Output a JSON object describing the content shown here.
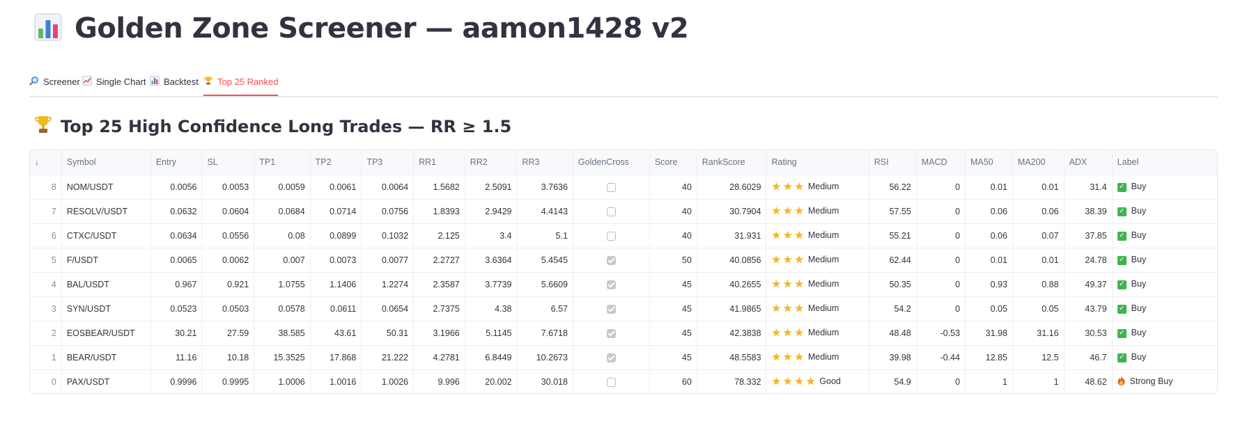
{
  "page": {
    "title_icon": "bar-chart-icon",
    "title": "Golden Zone Screener — aamon1428 v2"
  },
  "tabs": [
    {
      "label": "Screener",
      "icon": "magnifier-icon",
      "active": false
    },
    {
      "label": "Single Chart",
      "icon": "line-chart-icon",
      "active": false
    },
    {
      "label": "Backtest",
      "icon": "bar-chart-icon",
      "active": false
    },
    {
      "label": "Top 25 Ranked",
      "icon": "trophy-icon",
      "active": true
    }
  ],
  "section": {
    "icon": "trophy-icon",
    "title": "Top 25 High Confidence Long Trades — RR ≥ 1.5"
  },
  "table": {
    "sort_indicator": "↓",
    "columns": [
      "Symbol",
      "Entry",
      "SL",
      "TP1",
      "TP2",
      "TP3",
      "RR1",
      "RR2",
      "RR3",
      "GoldenCross",
      "Score",
      "RankScore",
      "Rating",
      "RSI",
      "MACD",
      "MA50",
      "MA200",
      "ADX",
      "Label"
    ],
    "rows": [
      {
        "idx": "8",
        "symbol": "NOM/USDT",
        "entry": "0.0056",
        "sl": "0.0053",
        "tp1": "0.0059",
        "tp2": "0.0061",
        "tp3": "0.0064",
        "rr1": "1.5682",
        "rr2": "2.5091",
        "rr3": "3.7636",
        "golden_cross": false,
        "score": "40",
        "rank_score": "28.6029",
        "stars": 3,
        "rating": "Medium",
        "rsi": "56.22",
        "macd": "0",
        "ma50": "0.01",
        "ma200": "0.01",
        "adx": "31.4",
        "label": "Buy",
        "label_icon": "check-icon"
      },
      {
        "idx": "7",
        "symbol": "RESOLV/USDT",
        "entry": "0.0632",
        "sl": "0.0604",
        "tp1": "0.0684",
        "tp2": "0.0714",
        "tp3": "0.0756",
        "rr1": "1.8393",
        "rr2": "2.9429",
        "rr3": "4.4143",
        "golden_cross": false,
        "score": "40",
        "rank_score": "30.7904",
        "stars": 3,
        "rating": "Medium",
        "rsi": "57.55",
        "macd": "0",
        "ma50": "0.06",
        "ma200": "0.06",
        "adx": "38.39",
        "label": "Buy",
        "label_icon": "check-icon"
      },
      {
        "idx": "6",
        "symbol": "CTXC/USDT",
        "entry": "0.0634",
        "sl": "0.0556",
        "tp1": "0.08",
        "tp2": "0.0899",
        "tp3": "0.1032",
        "rr1": "2.125",
        "rr2": "3.4",
        "rr3": "5.1",
        "golden_cross": false,
        "score": "40",
        "rank_score": "31.931",
        "stars": 3,
        "rating": "Medium",
        "rsi": "55.21",
        "macd": "0",
        "ma50": "0.06",
        "ma200": "0.07",
        "adx": "37.85",
        "label": "Buy",
        "label_icon": "check-icon"
      },
      {
        "idx": "5",
        "symbol": "F/USDT",
        "entry": "0.0065",
        "sl": "0.0062",
        "tp1": "0.007",
        "tp2": "0.0073",
        "tp3": "0.0077",
        "rr1": "2.2727",
        "rr2": "3.6364",
        "rr3": "5.4545",
        "golden_cross": true,
        "score": "50",
        "rank_score": "40.0856",
        "stars": 3,
        "rating": "Medium",
        "rsi": "62.44",
        "macd": "0",
        "ma50": "0.01",
        "ma200": "0.01",
        "adx": "24.78",
        "label": "Buy",
        "label_icon": "check-icon"
      },
      {
        "idx": "4",
        "symbol": "BAL/USDT",
        "entry": "0.967",
        "sl": "0.921",
        "tp1": "1.0755",
        "tp2": "1.1406",
        "tp3": "1.2274",
        "rr1": "2.3587",
        "rr2": "3.7739",
        "rr3": "5.6609",
        "golden_cross": true,
        "score": "45",
        "rank_score": "40.2655",
        "stars": 3,
        "rating": "Medium",
        "rsi": "50.35",
        "macd": "0",
        "ma50": "0.93",
        "ma200": "0.88",
        "adx": "49.37",
        "label": "Buy",
        "label_icon": "check-icon"
      },
      {
        "idx": "3",
        "symbol": "SYN/USDT",
        "entry": "0.0523",
        "sl": "0.0503",
        "tp1": "0.0578",
        "tp2": "0.0611",
        "tp3": "0.0654",
        "rr1": "2.7375",
        "rr2": "4.38",
        "rr3": "6.57",
        "golden_cross": true,
        "score": "45",
        "rank_score": "41.9865",
        "stars": 3,
        "rating": "Medium",
        "rsi": "54.2",
        "macd": "0",
        "ma50": "0.05",
        "ma200": "0.05",
        "adx": "43.79",
        "label": "Buy",
        "label_icon": "check-icon"
      },
      {
        "idx": "2",
        "symbol": "EOSBEAR/USDT",
        "entry": "30.21",
        "sl": "27.59",
        "tp1": "38.585",
        "tp2": "43.61",
        "tp3": "50.31",
        "rr1": "3.1966",
        "rr2": "5.1145",
        "rr3": "7.6718",
        "golden_cross": true,
        "score": "45",
        "rank_score": "42.3838",
        "stars": 3,
        "rating": "Medium",
        "rsi": "48.48",
        "macd": "-0.53",
        "ma50": "31.98",
        "ma200": "31.16",
        "adx": "30.53",
        "label": "Buy",
        "label_icon": "check-icon"
      },
      {
        "idx": "1",
        "symbol": "BEAR/USDT",
        "entry": "11.16",
        "sl": "10.18",
        "tp1": "15.3525",
        "tp2": "17.868",
        "tp3": "21.222",
        "rr1": "4.2781",
        "rr2": "6.8449",
        "rr3": "10.2673",
        "golden_cross": true,
        "score": "45",
        "rank_score": "48.5583",
        "stars": 3,
        "rating": "Medium",
        "rsi": "39.98",
        "macd": "-0.44",
        "ma50": "12.85",
        "ma200": "12.5",
        "adx": "46.7",
        "label": "Buy",
        "label_icon": "check-icon"
      },
      {
        "idx": "0",
        "symbol": "PAX/USDT",
        "entry": "0.9996",
        "sl": "0.9995",
        "tp1": "1.0006",
        "tp2": "1.0016",
        "tp3": "1.0026",
        "rr1": "9.996",
        "rr2": "20.002",
        "rr3": "30.018",
        "golden_cross": false,
        "score": "60",
        "rank_score": "78.332",
        "stars": 4,
        "rating": "Good",
        "rsi": "54.9",
        "macd": "0",
        "ma50": "1",
        "ma200": "1",
        "adx": "48.62",
        "label": "Strong Buy",
        "label_icon": "fire-icon"
      }
    ]
  },
  "colors": {
    "text": "#31333f",
    "accent": "#ff4b4b",
    "star": "#f2b91d",
    "check": "#3fb54d",
    "fire": "#f25a1d"
  }
}
